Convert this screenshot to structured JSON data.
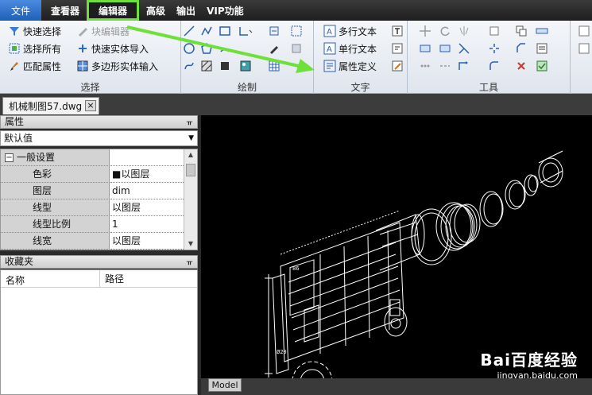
{
  "menu": {
    "file": "文件",
    "items": [
      "查看器",
      "编辑器",
      "高级",
      "输出",
      "VIP功能"
    ],
    "active_index": 1
  },
  "ribbon": {
    "select": {
      "label": "选择",
      "quick_select": "快速选择",
      "select_all": "选择所有",
      "match_props": "匹配属性",
      "block_editor": "块编辑器",
      "quick_solid_import": "快速实体导入",
      "polygon_solid_input": "多边形实体输入"
    },
    "draw": {
      "label": "绘制"
    },
    "text": {
      "label": "文字",
      "mtext": "多行文本",
      "single_text": "单行文本",
      "attr_def": "属性定义"
    },
    "tools": {
      "label": "工具"
    }
  },
  "document_tab": {
    "name": "机械制图57.dwg",
    "close": "×"
  },
  "properties": {
    "title": "属性",
    "pin": "ᚂ",
    "selector": "默认值",
    "section": "一般设置",
    "rows": [
      {
        "key": "色彩",
        "value": "■以图层"
      },
      {
        "key": "图层",
        "value": "dim"
      },
      {
        "key": "线型",
        "value": "以图层"
      },
      {
        "key": "线型比例",
        "value": "1"
      },
      {
        "key": "线宽",
        "value": "以图层"
      }
    ]
  },
  "favorites": {
    "title": "收藏夹",
    "col_name": "名称",
    "col_path": "路径"
  },
  "canvas": {
    "model_tab": "Model"
  },
  "watermark": {
    "brand": "Bai百度经验",
    "url": "jingyan.baidu.com"
  },
  "colors": {
    "highlight": "#6ee03a",
    "canvas_bg": "#000000",
    "menubar_bg": "#1e1e1e"
  }
}
